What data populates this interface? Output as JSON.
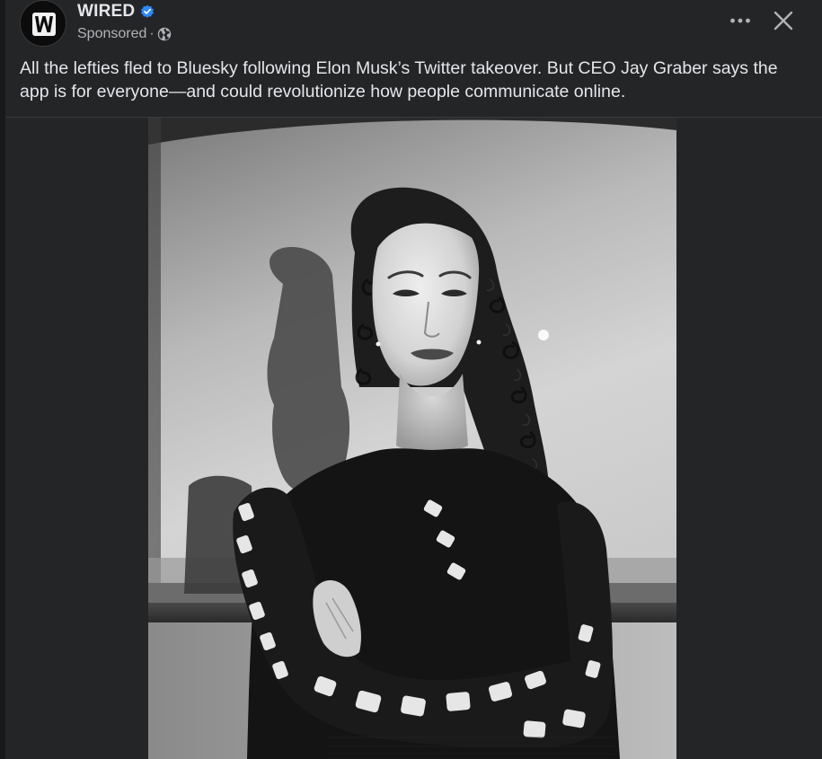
{
  "post": {
    "page_name": "WIRED",
    "sponsored_label": "Sponsored",
    "meta_separator": "·",
    "caption": "All the lefties fled to Bluesky following Elon Musk’s Twitter takeover. But CEO Jay Graber says the app is for everyone—and could revolutionize how people communicate online.",
    "avatar_icon": "wired-logo-icon",
    "audience_icon": "globe-icon",
    "verified_icon": "verified-badge-icon",
    "more_icon": "more-options-icon",
    "close_icon": "close-icon"
  },
  "colors": {
    "background": "#18191a",
    "card": "#242526",
    "primary_text": "#e4e6eb",
    "secondary_text": "#b0b3b8",
    "verified_blue": "#2d88ff"
  }
}
